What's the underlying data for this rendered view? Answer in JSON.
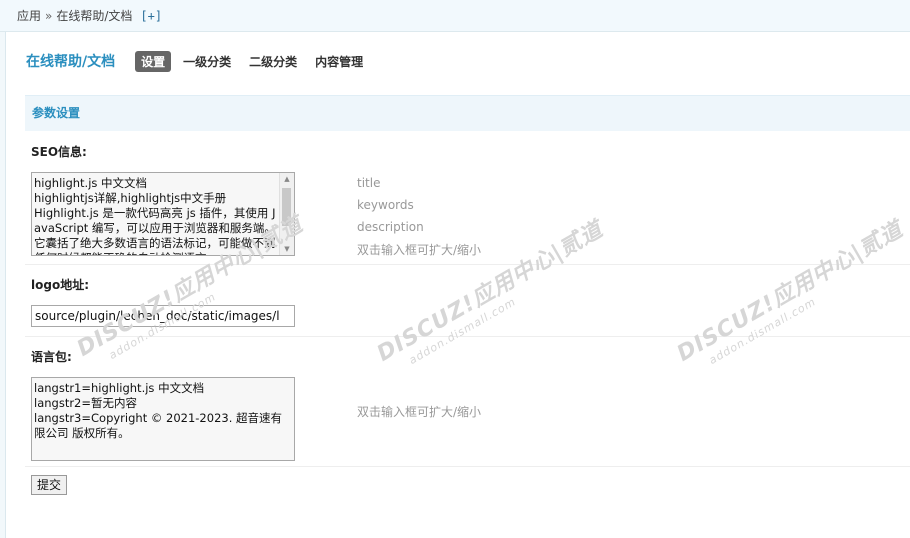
{
  "breadcrumb": {
    "root": "应用",
    "separator": "»",
    "current": "在线帮助/文档",
    "add": "[+]"
  },
  "nav": {
    "app_title": "在线帮助/文档",
    "tabs": [
      {
        "label": "设置",
        "active": true
      },
      {
        "label": "一级分类",
        "active": false
      },
      {
        "label": "二级分类",
        "active": false
      },
      {
        "label": "内容管理",
        "active": false
      }
    ]
  },
  "section": {
    "title": "参数设置"
  },
  "seo": {
    "label": "SEO信息:",
    "value": "highlight.js 中文文档\nhighlightjs详解,highlightjs中文手册\nHighlight.js 是一款代码高亮 js 插件，其使用 JavaScript 编写，可以应用于浏览器和服务端。它囊括了绝大多数语言的语法标记，可能做不到任何时候都能正确的自动检测语言",
    "hints": [
      "title",
      "keywords",
      "description",
      "双击输入框可扩大/缩小"
    ]
  },
  "logo": {
    "label": "logo地址:",
    "value": "source/plugin/lechen_doc/static/images/l"
  },
  "lang": {
    "label": "语言包:",
    "value": "langstr1=highlight.js 中文文档\nlangstr2=暂无内容\nlangstr3=Copyright © 2021-2023. 超音速有限公司 版权所有。",
    "hint": "双击输入框可扩大/缩小"
  },
  "submit_label": "提交",
  "watermark": {
    "main": "DISCUZ!应用中心|贰道",
    "sub": "addon.dismall.com"
  },
  "colors": {
    "accent": "#2b8fbf",
    "header_bg": "#eef6fb",
    "active_tab": "#666666"
  }
}
